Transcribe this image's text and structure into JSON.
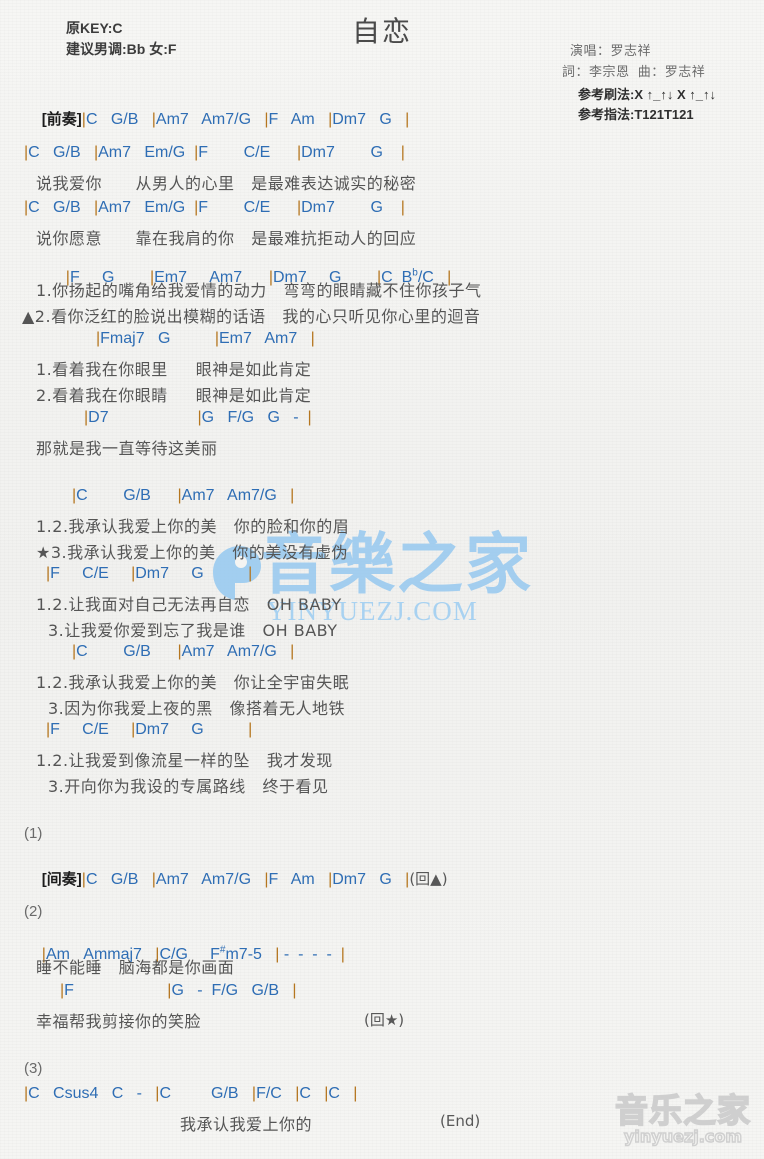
{
  "header": {
    "original_key": "原KEY:C",
    "suggested_key": "建议男调:Bb 女:F",
    "title": "自恋",
    "singer": "演唱：罗志祥",
    "writers": "詞：李宗恩  曲：罗志祥",
    "strum_pattern": "参考刷法:X ↑_↑↓ X ↑_↑↓",
    "fingering_pattern": "参考指法:T121T121"
  },
  "colors": {
    "chord": "#2e6db4",
    "barline": "#b5761f",
    "lyric": "#555555",
    "watermark_blue": "#8ec5f0",
    "page_background": "#f4f4f2"
  },
  "watermark": {
    "center_text": "音樂之家",
    "center_domain": "YINYUEZJ.COM",
    "bottom_text": "音乐之家",
    "bottom_domain": "yinyuezj.com"
  },
  "intro": {
    "label": "[前奏]",
    "chords": "|C   G/B   |Am7   Am7/G   |F   Am   |Dm7   G   |"
  },
  "verse1": {
    "line1_chords": "|C   G/B   |Am7   Em/G  |F        C/E      |Dm7        G    |",
    "line1_lyric": "说我爱你      从男人的心里   是最难表达诚实的秘密",
    "line2_chords": "|C   G/B   |Am7   Em/G  |F        C/E      |Dm7        G    |",
    "line2_lyric": "说你愿意      靠在我肩的你   是最难抗拒动人的回应"
  },
  "prechorus": {
    "chords": "|F     G        |Em7     Am7      |Dm7     G        |C   B♭/C   |",
    "lyric1": "1.你扬起的嘴角给我爱情的动力   弯弯的眼睛藏不住你孩子气",
    "lyric2": "▲2.看你泛红的脸说出模糊的话语   我的心只听见你心里的迴音",
    "chords2": "|Fmaj7   G          |Em7   Am7   |",
    "lyric3": "1.看着我在你眼里     眼神是如此肯定",
    "lyric4": "2.看着我在你眼睛     眼神是如此肯定",
    "chords3": "|D7                    |G   F/G   G   -  |",
    "lyric5": "那就是我一直等待这美丽"
  },
  "chorus": {
    "line1_chords": "|C        G/B      |Am7   Am7/G   |",
    "line1_lyric_a": "1.2.我承认我爱上你的美   你的脸和你的眉",
    "line1_lyric_b": "★3.我承认我爱上你的美   你的美没有虚伪",
    "line2_chords": "|F     C/E     |Dm7     G          |",
    "line2_lyric_a": "1.2.让我面对自己无法再自恋   OH BABY",
    "line2_lyric_b": "3.让我爱你爱到忘了我是谁   OH BABY",
    "line3_chords": "|C        G/B      |Am7   Am7/G   |",
    "line3_lyric_a": "1.2.我承认我爱上你的美   你让全宇宙失眠",
    "line3_lyric_b": "3.因为你我爱上夜的黑   像搭着无人地铁",
    "line4_chords": "|F     C/E     |Dm7     G          |",
    "line4_lyric_a": "1.2.让我爱到像流星一样的坠   我才发现",
    "line4_lyric_b": "3.开向你为我设的专属路线   终于看见"
  },
  "part1": {
    "number": "(1)",
    "label": "[间奏]",
    "chords": "|C   G/B   |Am7   Am7/G   |F   Am   |Dm7   G   |",
    "cue": "(回▲)"
  },
  "part2": {
    "number": "(2)",
    "chords1": "|Am   Ammaj7   |C/G     F#m7-5   | -  -  -  -  |",
    "lyric1": "睡不能睡   脑海都是你画面",
    "chords2": "|F                     |G   -  F/G   G/B   |",
    "lyric2": "幸福帮我剪接你的笑脸",
    "cue": "(回★)"
  },
  "part3": {
    "number": "(3)",
    "chords": "|C   Csus4   C   -   |C         G/B   |F/C   |C   |C   |",
    "lyric": "我承认我爱上你的",
    "cue": "(End)"
  }
}
